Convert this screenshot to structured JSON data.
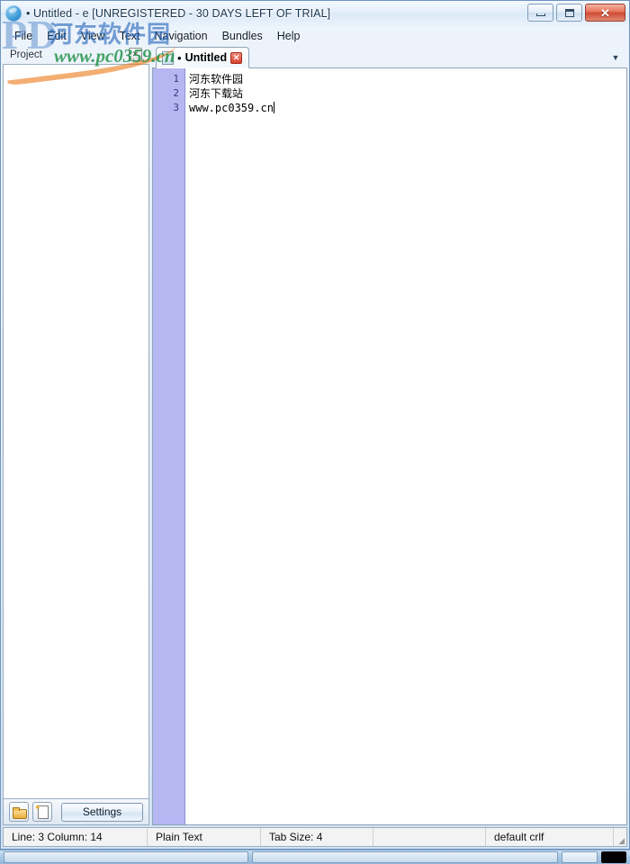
{
  "window": {
    "title": "• Untitled - e  [UNREGISTERED - 30 DAYS LEFT OF TRIAL]",
    "app_icon_name": "e-text-editor-icon",
    "controls": {
      "minimize": "–",
      "maximize": "□",
      "close": "✕"
    }
  },
  "menu": {
    "items": [
      {
        "label": "File"
      },
      {
        "label": "Edit"
      },
      {
        "label": "View"
      },
      {
        "label": "Text"
      },
      {
        "label": "Navigation"
      },
      {
        "label": "Bundles"
      },
      {
        "label": "Help"
      }
    ]
  },
  "project_panel": {
    "title": "Project",
    "close_glyph": "✕",
    "tree_items": [],
    "toolbar": {
      "new_folder_tooltip": "New Folder",
      "new_file_tooltip": "New File",
      "settings_label": "Settings"
    }
  },
  "editor": {
    "tab": {
      "modified_dot": "•",
      "label": "Untitled",
      "close_glyph": "✕"
    },
    "overflow_glyph": "▼",
    "lines": [
      {
        "number": "1",
        "text": "河东软件园",
        "cjk": true
      },
      {
        "number": "2",
        "text": "河东下载站",
        "cjk": true
      },
      {
        "number": "3",
        "text": "www.pc0359.cn",
        "cjk": false
      }
    ],
    "caret_line": 3,
    "gutter_color": "#b6b6f2"
  },
  "status_bar": {
    "cells": [
      {
        "text": "Line: 3  Column: 14",
        "width": 160
      },
      {
        "text": "Plain Text",
        "width": 126
      },
      {
        "text": "Tab Size: 4",
        "width": 125
      },
      {
        "text": "",
        "width": 125
      },
      {
        "text": "default crlf",
        "width": 150
      }
    ]
  },
  "watermark": {
    "cjk_text": "河东软件园",
    "url_text": "www.pc0359.cn",
    "logo_text": "PD",
    "cjk_color": "#2364b9",
    "url_color": "#168c3c"
  },
  "taskbar": {
    "items": [
      "",
      "",
      "",
      ""
    ]
  }
}
